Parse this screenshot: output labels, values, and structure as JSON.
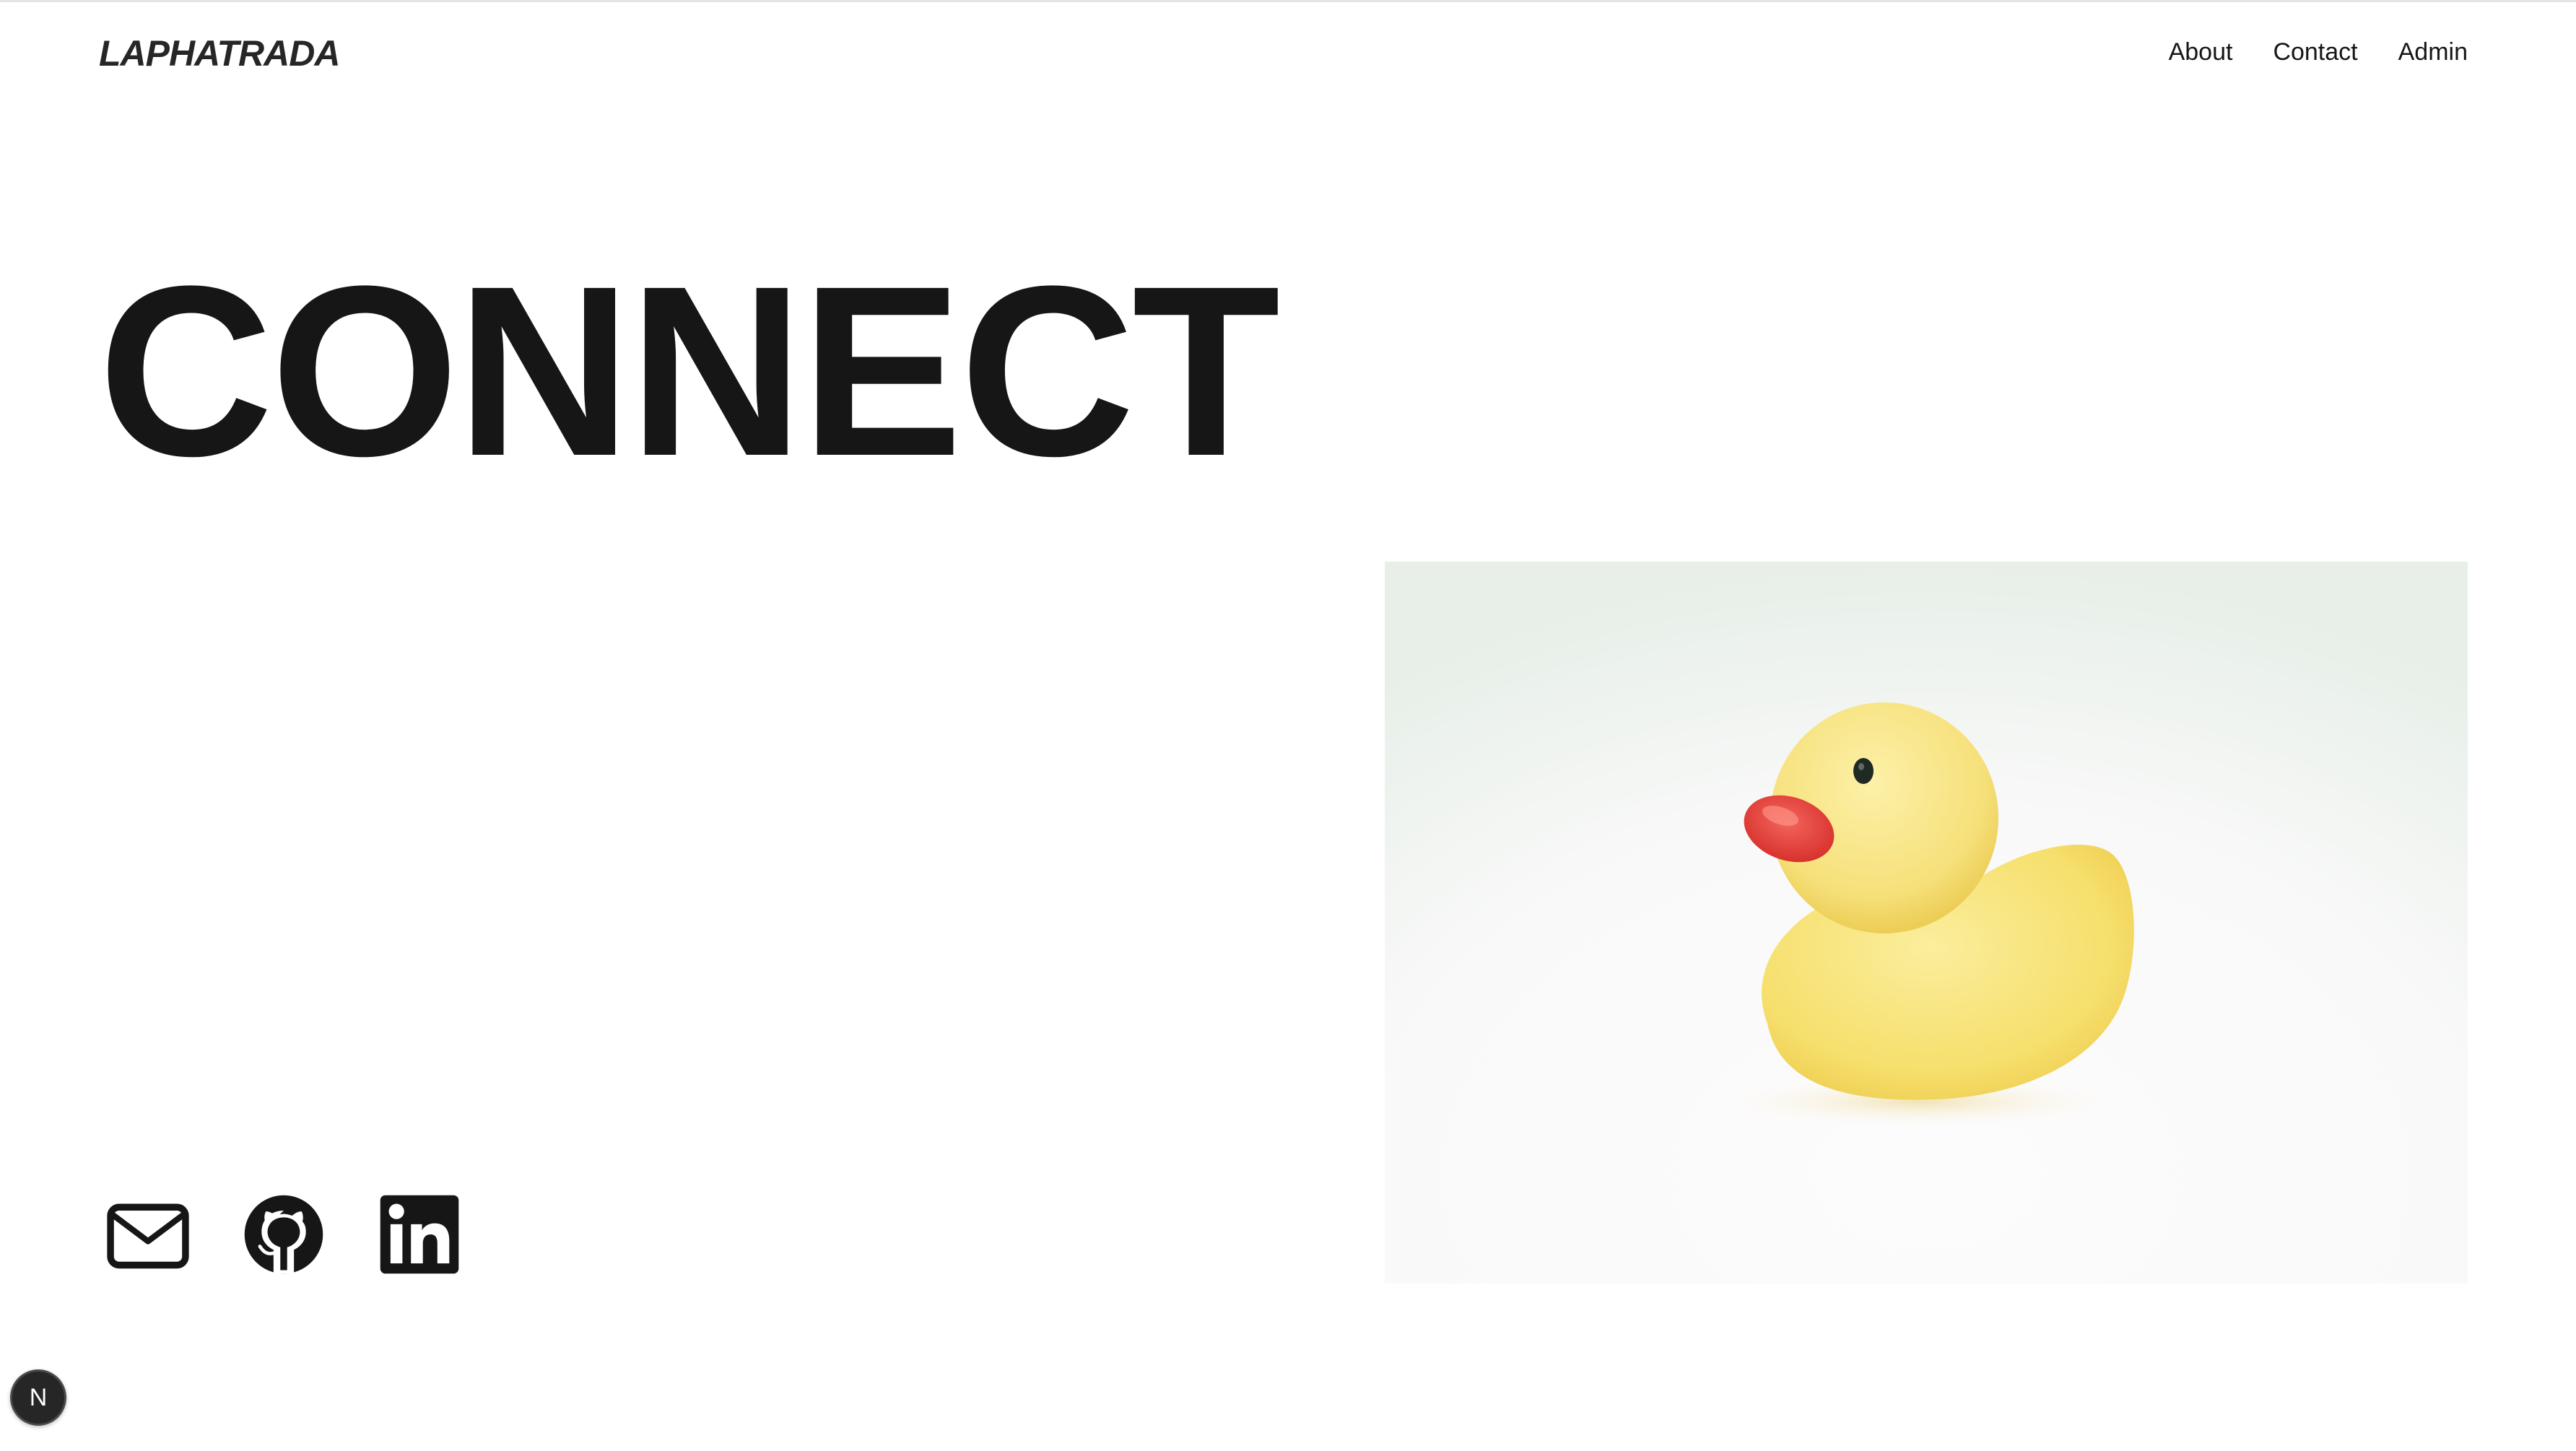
{
  "header": {
    "logo": "LAPHATRADA",
    "nav": [
      {
        "label": "About"
      },
      {
        "label": "Contact"
      },
      {
        "label": "Admin"
      }
    ]
  },
  "hero": {
    "title": "CONNECT"
  },
  "socials": [
    {
      "icon": "mail-icon"
    },
    {
      "icon": "github-icon"
    },
    {
      "icon": "linkedin-icon"
    }
  ],
  "dev_badge": {
    "label": "N",
    "icon": "nextjs-icon"
  },
  "colors": {
    "text": "#161616",
    "background": "#ffffff",
    "duck_body": "#f7e37a",
    "duck_beak": "#e0403a"
  }
}
